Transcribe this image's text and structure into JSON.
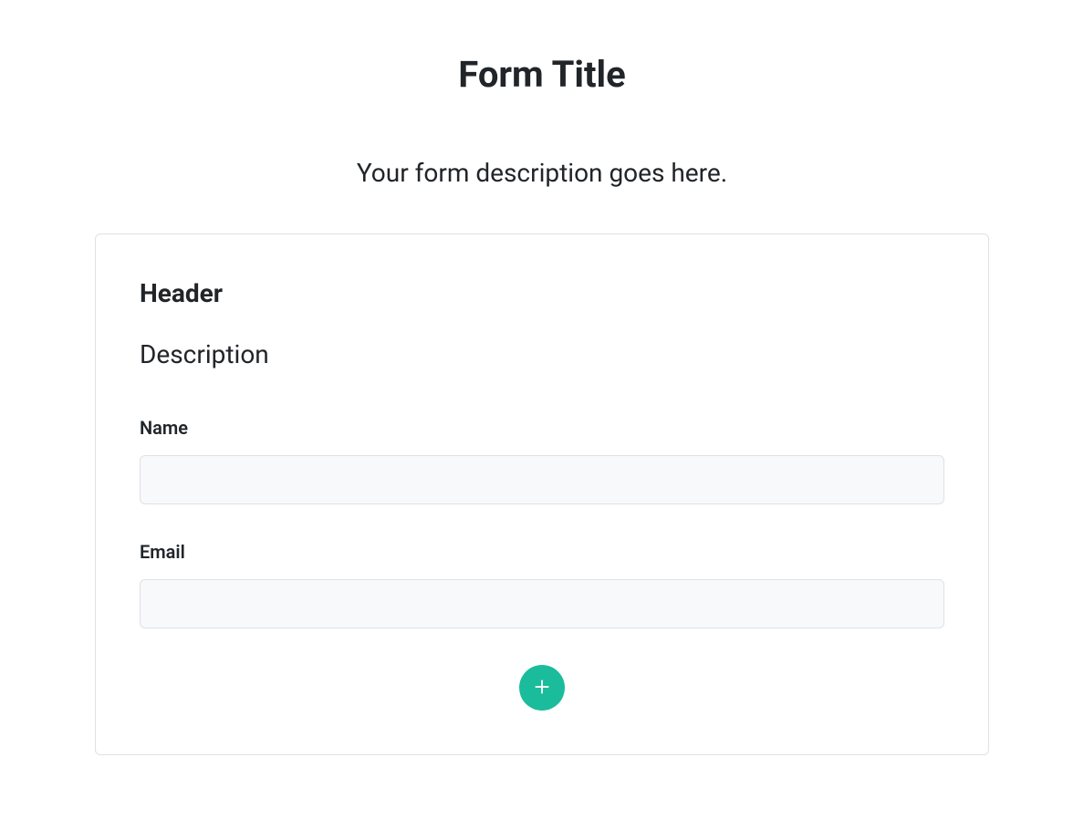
{
  "form": {
    "title": "Form Title",
    "description": "Your form description goes here."
  },
  "card": {
    "header": "Header",
    "subheader": "Description",
    "fields": [
      {
        "label": "Name",
        "value": ""
      },
      {
        "label": "Email",
        "value": ""
      }
    ],
    "add_button_label": "Add"
  },
  "colors": {
    "accent": "#1abc9c",
    "border": "#dee2e6",
    "input_bg": "#f8f9fa"
  }
}
